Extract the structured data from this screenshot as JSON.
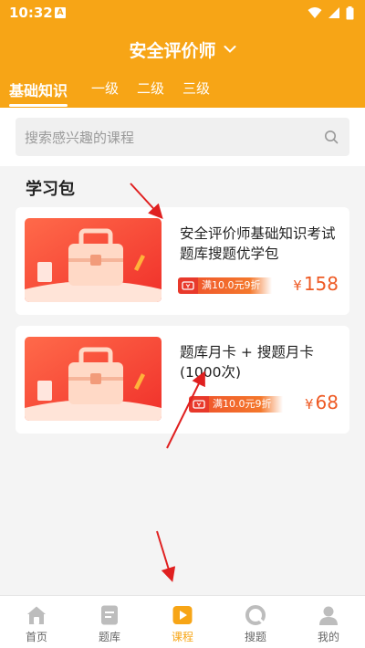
{
  "status_bar": {
    "time": "10:32",
    "notif_letter": "A"
  },
  "header": {
    "title": "安全评价师"
  },
  "tabs": [
    {
      "label": "基础知识",
      "active": true
    },
    {
      "label": "一级",
      "active": false
    },
    {
      "label": "二级",
      "active": false
    },
    {
      "label": "三级",
      "active": false
    }
  ],
  "search": {
    "placeholder": "搜索感兴趣的课程"
  },
  "section": {
    "title": "学习包"
  },
  "courses": [
    {
      "title": "安全评价师基础知识考试题库搜题优学包",
      "promo": "满10.0元9折",
      "currency": "¥",
      "price": "158"
    },
    {
      "title": "题库月卡 + 搜题月卡(1000次)",
      "promo": "满10.0元9折",
      "currency": "¥",
      "price": "68"
    }
  ],
  "bottom_nav": [
    {
      "label": "首页",
      "icon": "home-icon",
      "active": false
    },
    {
      "label": "题库",
      "icon": "document-icon",
      "active": false
    },
    {
      "label": "课程",
      "icon": "play-icon",
      "active": true
    },
    {
      "label": "搜题",
      "icon": "search-circle-icon",
      "active": false
    },
    {
      "label": "我的",
      "icon": "user-icon",
      "active": false
    }
  ],
  "colors": {
    "primary": "#f7a516",
    "price": "#ee5a24",
    "promo": "#e8392b",
    "annotation": "#e02020"
  }
}
